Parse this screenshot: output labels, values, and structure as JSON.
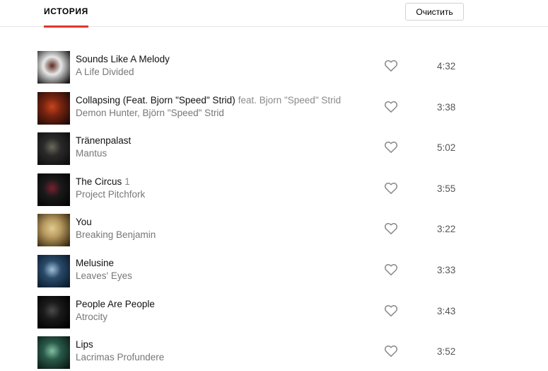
{
  "header": {
    "tab_label": "ИСТОРИЯ",
    "clear_label": "Очистить",
    "accent_color": "#e3352c"
  },
  "tracks": [
    {
      "title": "Sounds Like A Melody",
      "feat": "",
      "artist": "A Life Divided",
      "duration": "4:32",
      "cover_colors": [
        "#e8e8e8",
        "#1a1a1a",
        "#5a2a20"
      ]
    },
    {
      "title": "Collapsing (Feat. Bjorn \"Speed\" Strid)",
      "feat": "feat. Bjorn \"Speed\" Strid",
      "artist": "Demon Hunter, Björn \"Speed\" Strid",
      "duration": "3:38",
      "cover_colors": [
        "#7a2410",
        "#1c0c08",
        "#c8451e"
      ]
    },
    {
      "title": "Tränenpalast",
      "feat": "",
      "artist": "Mantus",
      "duration": "5:02",
      "cover_colors": [
        "#2a2a2a",
        "#0e0e0e",
        "#6a6a5a"
      ]
    },
    {
      "title": "The Circus",
      "feat": "1",
      "artist": "Project Pitchfork",
      "duration": "3:55",
      "cover_colors": [
        "#1a1a1a",
        "#050505",
        "#7a2030"
      ]
    },
    {
      "title": "You",
      "feat": "",
      "artist": "Breaking Benjamin",
      "duration": "3:22",
      "cover_colors": [
        "#b89a60",
        "#3a2a10",
        "#e0cc90"
      ]
    },
    {
      "title": "Melusine",
      "feat": "",
      "artist": "Leaves' Eyes",
      "duration": "3:33",
      "cover_colors": [
        "#2a4a6a",
        "#0a1a2a",
        "#a0c0d8"
      ]
    },
    {
      "title": "People Are People",
      "feat": "",
      "artist": "Atrocity",
      "duration": "3:43",
      "cover_colors": [
        "#1a1a1a",
        "#000000",
        "#4a4a4a"
      ]
    },
    {
      "title": "Lips",
      "feat": "",
      "artist": "Lacrimas Profundere",
      "duration": "3:52",
      "cover_colors": [
        "#2a5a4a",
        "#0a1a14",
        "#80c0a0"
      ]
    }
  ]
}
